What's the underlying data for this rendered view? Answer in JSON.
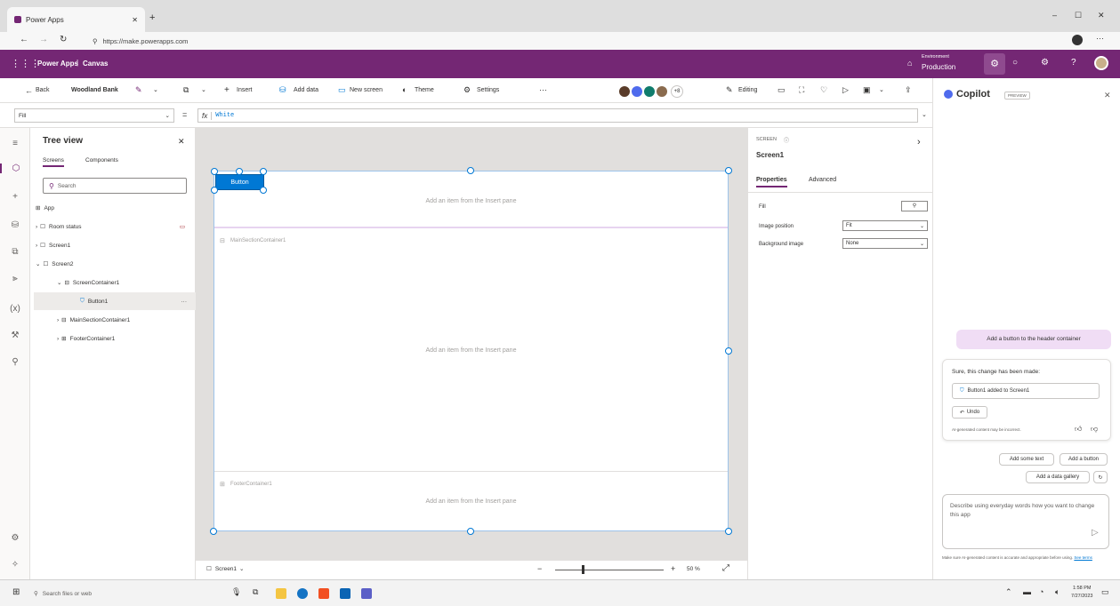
{
  "browser": {
    "tab_title": "Power Apps",
    "url": "https://make.powerapps.com",
    "new_tab": "+"
  },
  "header": {
    "app_name": "Power Apps",
    "separator": "|",
    "mode": "Canvas",
    "env_label": "Environment",
    "env_name": "Production"
  },
  "command_bar": {
    "back": "Back",
    "app_title": "Woodland Bank",
    "insert": "Insert",
    "add_data": "Add data",
    "new_screen": "New screen",
    "theme": "Theme",
    "settings": "Settings",
    "more": "···",
    "collab_count": "+8",
    "editing": "Editing"
  },
  "formula_bar": {
    "property": "Fill",
    "eq": "=",
    "fx": "fx",
    "value": "White"
  },
  "tree": {
    "title": "Tree view",
    "tab_screens": "Screens",
    "tab_components": "Components",
    "search_placeholder": "Search",
    "items": [
      {
        "label": "App"
      },
      {
        "label": "Room status"
      },
      {
        "label": "Screen1"
      },
      {
        "label": "Screen2"
      },
      {
        "label": "ScreenContainer1"
      },
      {
        "label": "Button1"
      },
      {
        "label": "MainSectionContainer1"
      },
      {
        "label": "FooterContainer1"
      }
    ],
    "more": "···"
  },
  "canvas": {
    "button_label": "Button",
    "add_item_hint": "Add an item from the Insert pane",
    "main_container": "MainSectionContainer1",
    "footer_container": "FooterContainer1"
  },
  "bottom_bar": {
    "screen": "Screen1",
    "minus": "−",
    "plus": "+",
    "zoom": "50 %"
  },
  "properties": {
    "kind": "SCREEN",
    "name": "Screen1",
    "tab_properties": "Properties",
    "tab_advanced": "Advanced",
    "fill_label": "Fill",
    "image_position_label": "Image position",
    "image_position_value": "Fit",
    "background_image_label": "Background image",
    "background_image_value": "None"
  },
  "copilot": {
    "title": "Copilot",
    "badge": "PREVIEW",
    "user_message": "Add a button to the header container",
    "reply": "Sure, this change has been made:",
    "change_item": "Button1 added to Screen1",
    "undo": "Undo",
    "disclaimer": "AI-generated content may be incorrect.",
    "suggestions": [
      "Add some text",
      "Add a button",
      "Add a data gallery"
    ],
    "input_placeholder": "Describe using everyday words how you want to change this app",
    "footer_note": "Make sure AI-generated content is accurate and appropriate before using.",
    "footer_link": "See terms"
  },
  "taskbar": {
    "search_placeholder": "Search files or web",
    "time": "1:58 PM",
    "date": "7/27/2023"
  },
  "colors": {
    "brand": "#742774",
    "accent": "#0078d4"
  }
}
